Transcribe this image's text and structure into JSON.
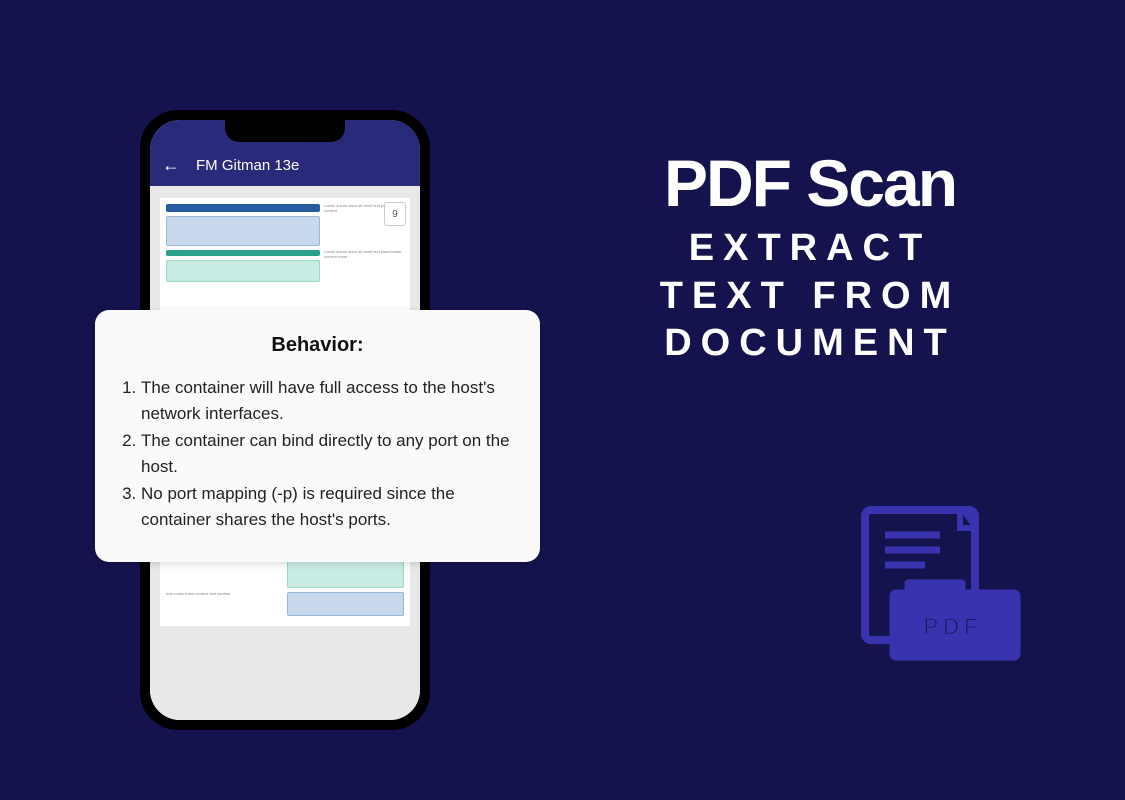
{
  "phone": {
    "status_left": "",
    "status_right": "",
    "back_arrow": "←",
    "title": "FM Gitman 13e",
    "page_number": "9"
  },
  "extract": {
    "heading": "Behavior:",
    "items": [
      "The container will have full access to the host's network interfaces.",
      "The container can bind directly to any port on the host.",
      "No port mapping (-p) is required since the container shares the host's ports."
    ]
  },
  "headline": {
    "main": "PDF Scan",
    "sub_line1": "EXTRACT",
    "sub_line2": "TEXT FROM",
    "sub_line3": "DOCUMENT"
  },
  "pdf_icon": {
    "label": "PDF"
  }
}
